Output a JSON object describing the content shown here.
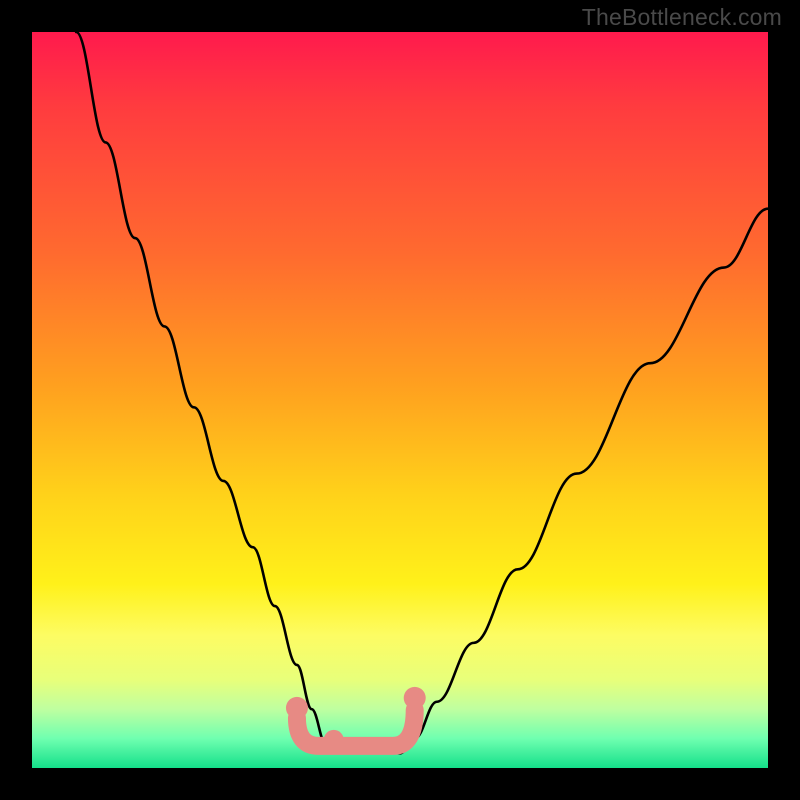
{
  "watermark": "TheBottleneck.com",
  "chart_data": {
    "type": "line",
    "title": "",
    "xlabel": "",
    "ylabel": "",
    "xlim": [
      0,
      100
    ],
    "ylim": [
      0,
      100
    ],
    "series": [
      {
        "name": "curve",
        "x": [
          6,
          10,
          14,
          18,
          22,
          26,
          30,
          33,
          36,
          38,
          40,
          50,
          52,
          55,
          60,
          66,
          74,
          84,
          94,
          100
        ],
        "values": [
          100,
          85,
          72,
          60,
          49,
          39,
          30,
          22,
          14,
          8,
          3,
          2,
          4,
          9,
          17,
          27,
          40,
          55,
          68,
          76
        ]
      }
    ],
    "flat_zone": {
      "x_start": 36,
      "x_end": 52,
      "y": 3
    },
    "marker_color": "#e78a84",
    "curve_color": "#000000"
  }
}
